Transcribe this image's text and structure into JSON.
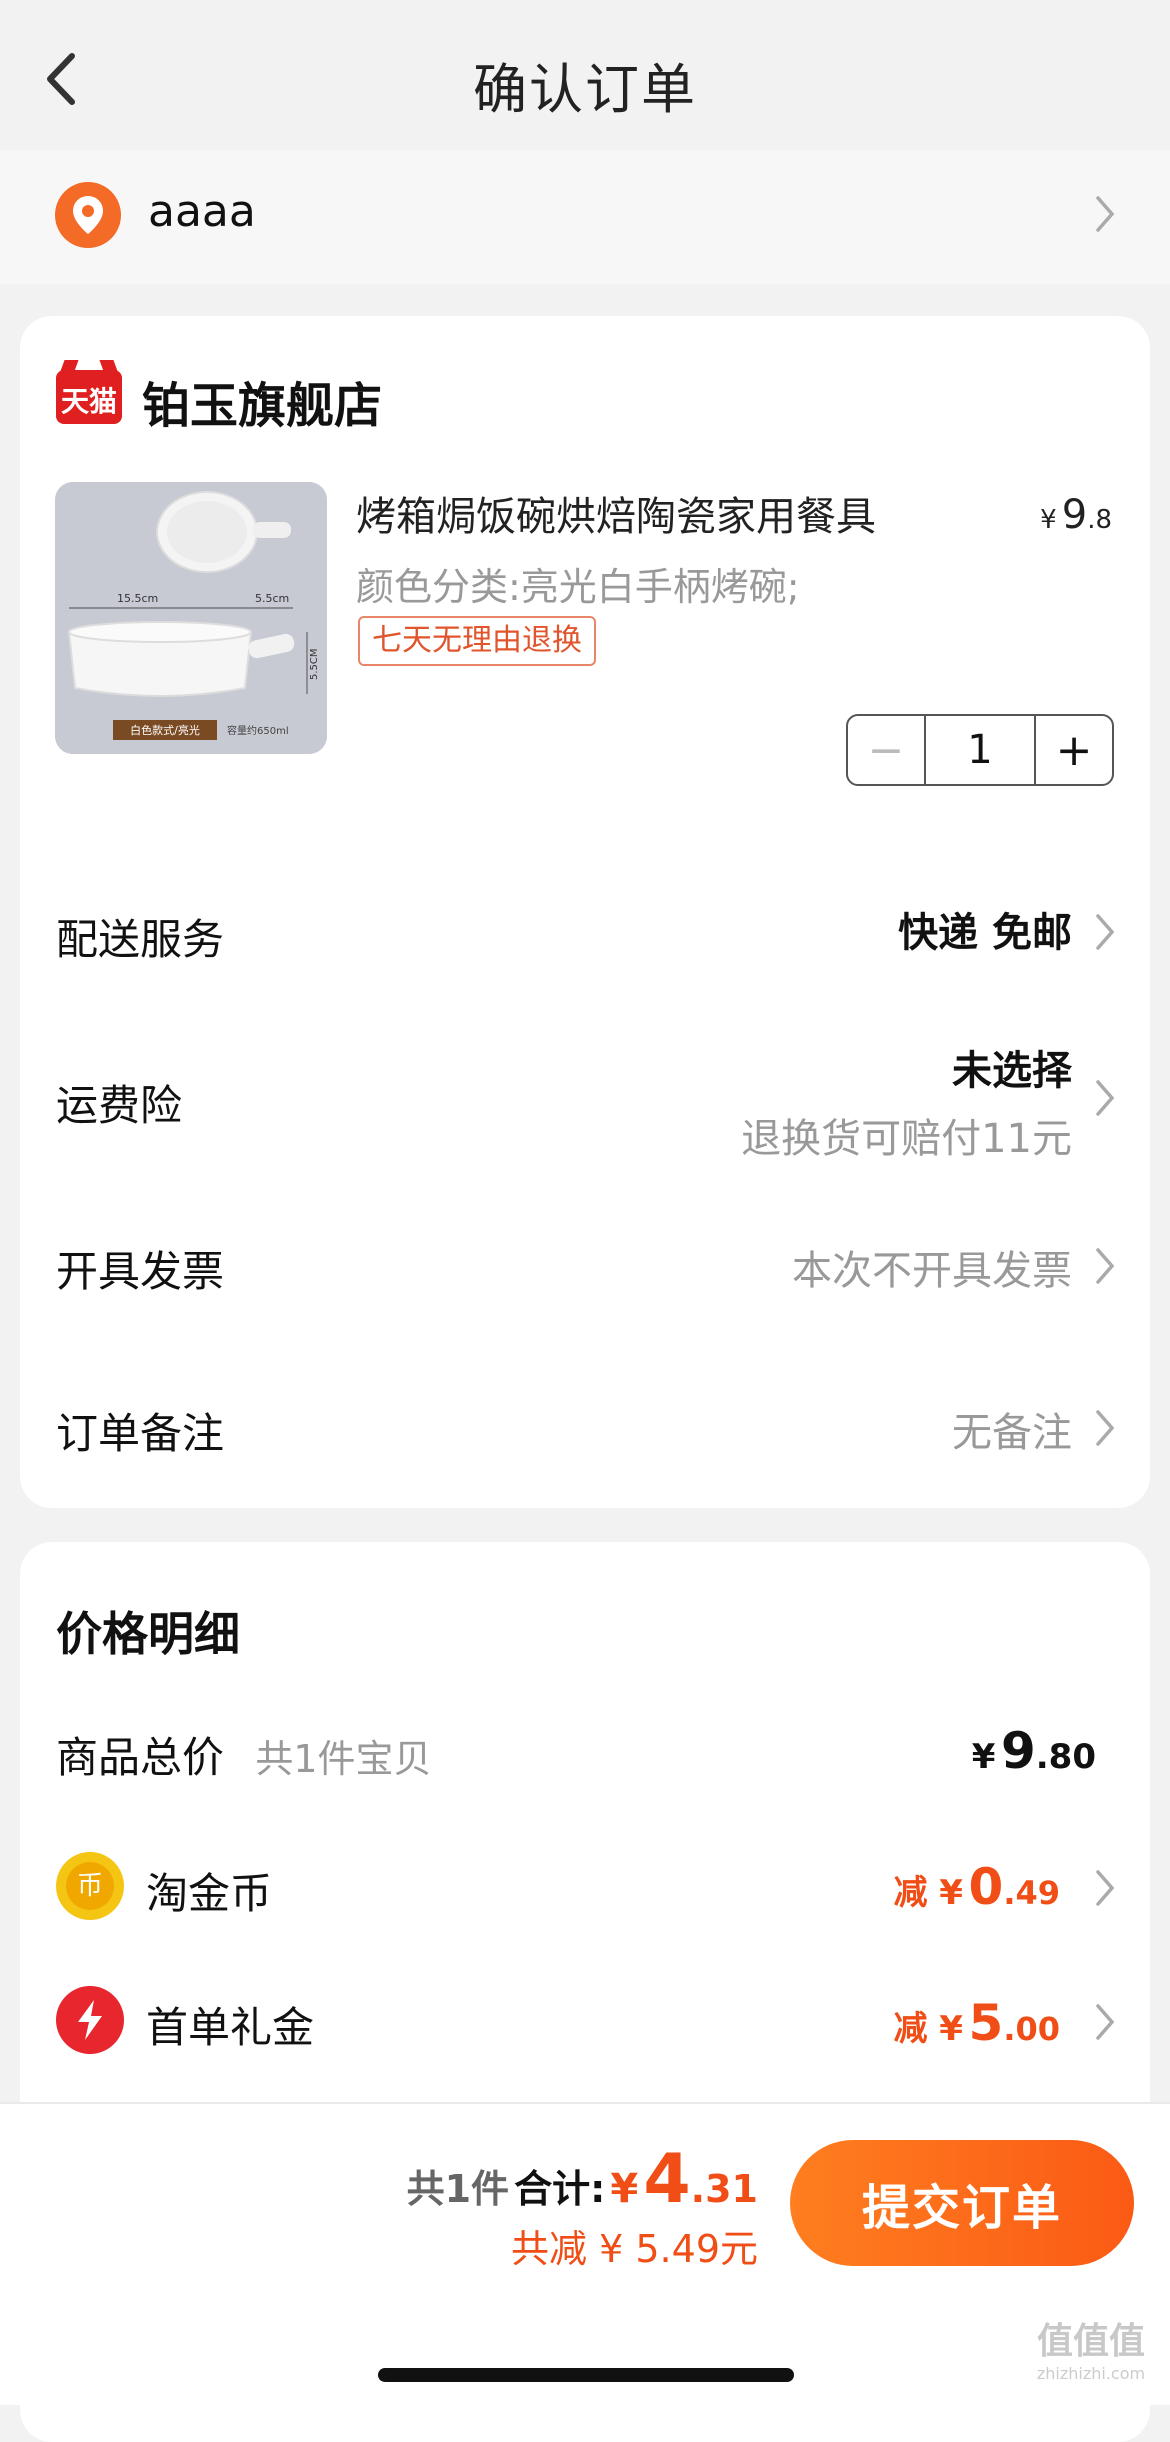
{
  "header": {
    "title": "确认订单"
  },
  "address": {
    "text": "aaaa"
  },
  "store": {
    "logo_text": "天猫",
    "name": "铂玉旗舰店"
  },
  "product": {
    "title": "烤箱焗饭碗烘焙陶瓷家用餐具",
    "price_currency": "¥",
    "price_int": "9",
    "price_dec": ".8",
    "variant": "颜色分类:亮光白手柄烤碗;",
    "tag": "七天无理由退换",
    "quantity": "1",
    "image_labels": {
      "dim_width": "15.5cm",
      "dim_handle": "5.5cm",
      "dim_height": "5.5CM",
      "caption": "白色款式/亮光",
      "capacity": "容量约650ml"
    }
  },
  "rows": {
    "delivery": {
      "label": "配送服务",
      "value": "快递 免邮"
    },
    "insurance": {
      "label": "运费险",
      "value": "未选择",
      "sub": "退换货可赔付11元"
    },
    "invoice": {
      "label": "开具发票",
      "value": "本次不开具发票"
    },
    "remark": {
      "label": "订单备注",
      "value": "无备注"
    }
  },
  "price_detail": {
    "title": "价格明细",
    "goods_total": {
      "label": "商品总价",
      "sub": "共1件宝贝",
      "cur": "¥",
      "int": "9",
      "dec": ".80"
    },
    "coin": {
      "icon_text": "币",
      "label": "淘金币",
      "prefix": "减 ¥",
      "int": "0",
      "dec": ".49"
    },
    "gift": {
      "label": "首单礼金",
      "prefix": "减 ¥",
      "int": "5",
      "dec": ".00"
    }
  },
  "bottom": {
    "count": "共1件",
    "total_label": "合计:",
    "cur": "¥",
    "int": "4",
    "dec": ".31",
    "saved": "共减 ¥ 5.49元",
    "submit": "提交订单"
  },
  "watermark": {
    "text": "值值值",
    "sub": "zhizhizhi.com"
  },
  "colors": {
    "accent": "#f04e16",
    "brand_red": "#e02020",
    "button": "#fb5a15"
  },
  "icons": [
    "back-chevron-icon",
    "location-pin-icon",
    "tmall-logo",
    "chevron-right-icon",
    "coin-icon",
    "lightning-icon"
  ]
}
